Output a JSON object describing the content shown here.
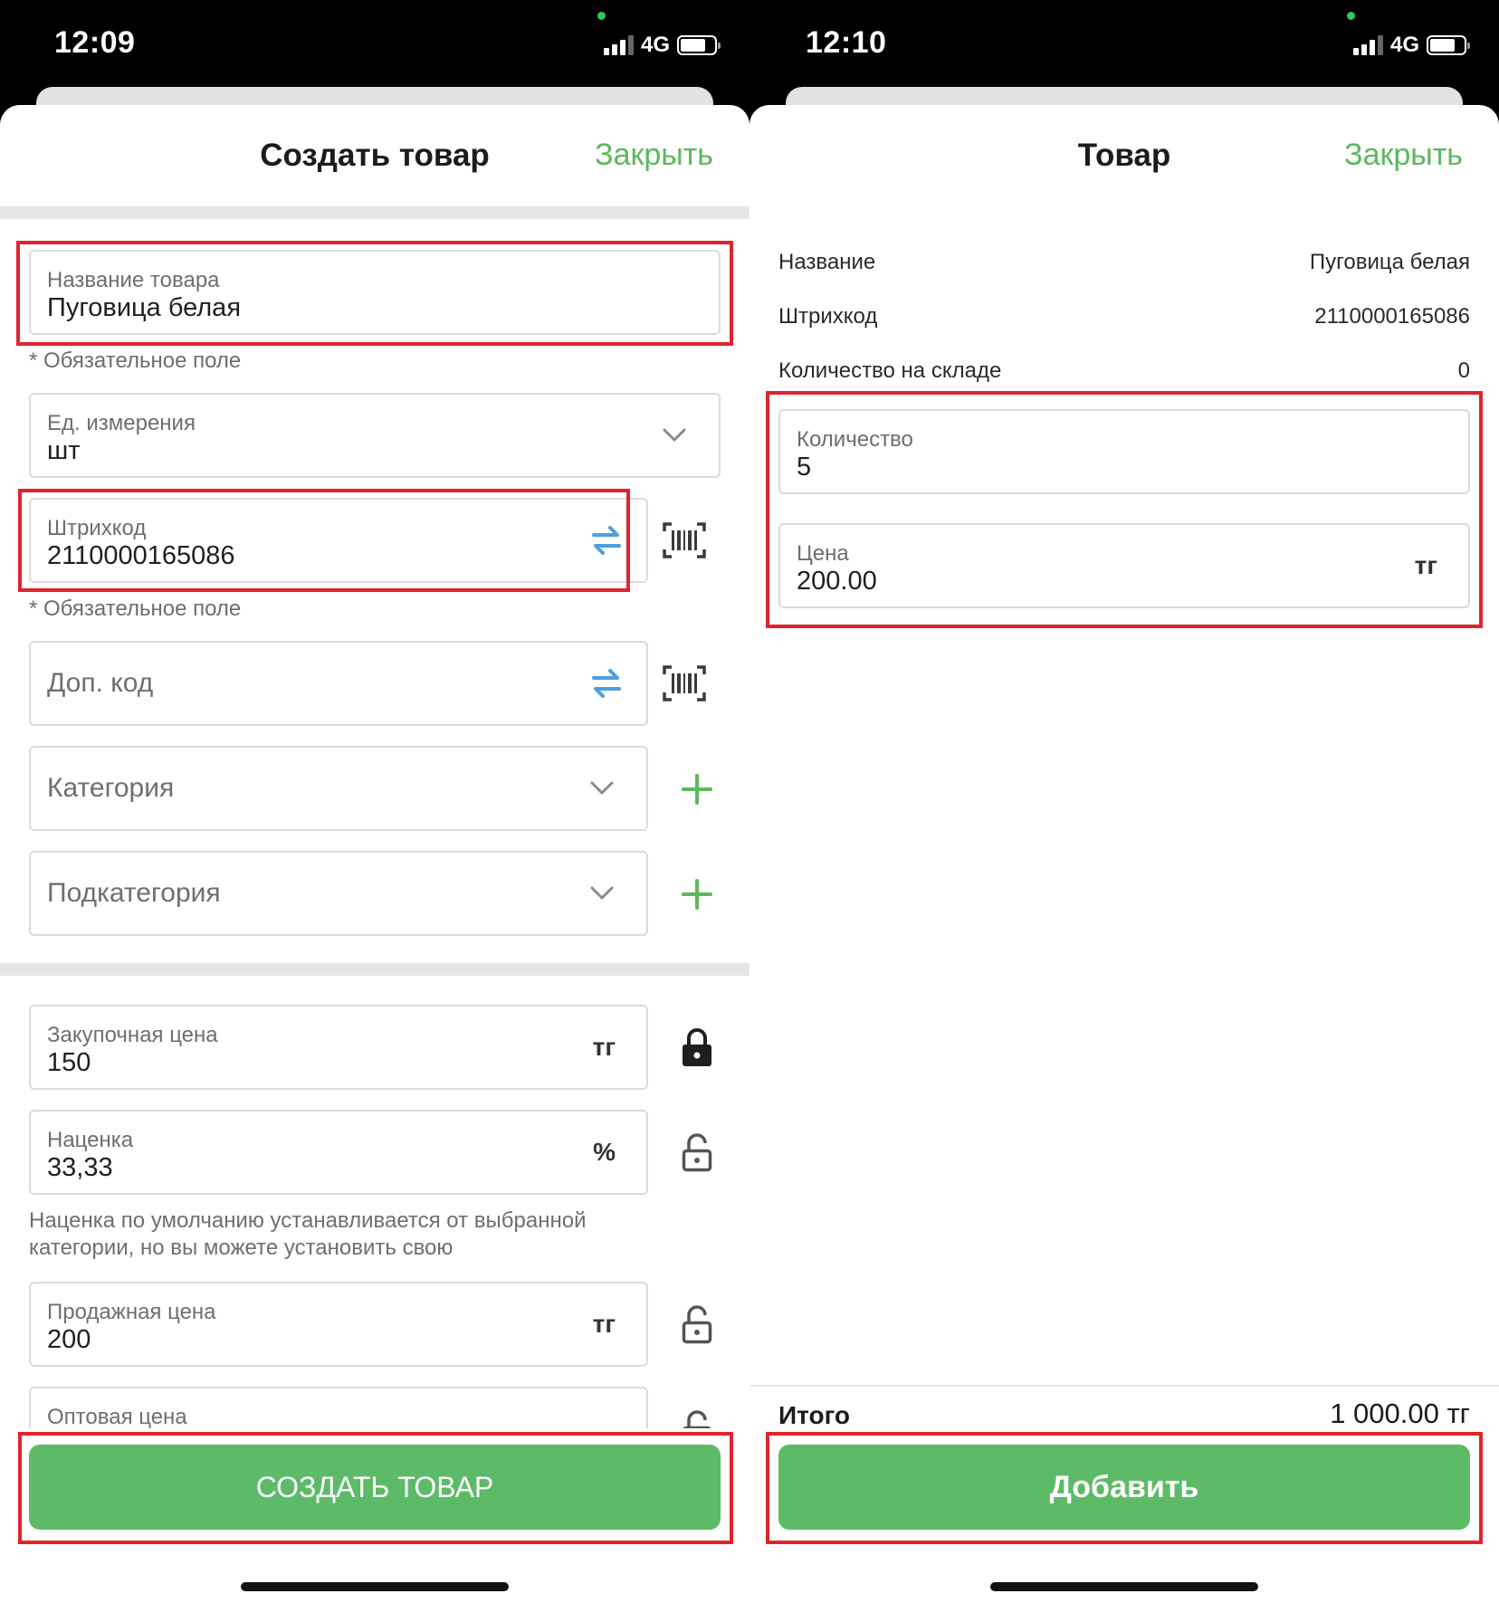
{
  "left": {
    "status": {
      "time": "12:09",
      "network": "4G"
    },
    "header": {
      "title": "Создать товар",
      "close_label": "Закрыть"
    },
    "fields": {
      "name": {
        "label": "Название товара",
        "value": "Пуговица белая",
        "hint": "* Обязательное поле"
      },
      "unit": {
        "label": "Ед. измерения",
        "value": "шт"
      },
      "barcode": {
        "label": "Штрихкод",
        "value": "2110000165086",
        "hint": "* Обязательное поле"
      },
      "extra_code": {
        "placeholder": "Доп. код"
      },
      "category": {
        "placeholder": "Категория"
      },
      "subcategory": {
        "placeholder": "Подкатегория"
      },
      "purchase_price": {
        "label": "Закупочная цена",
        "value": "150",
        "suffix": "тг"
      },
      "markup": {
        "label": "Наценка",
        "value": "33,33",
        "suffix": "%",
        "hint": "Наценка по умолчанию устанавливается от выбранной категории, но вы можете установить свою"
      },
      "sale_price": {
        "label": "Продажная цена",
        "value": "200",
        "suffix": "тг"
      },
      "wholesale_price": {
        "label": "Оптовая цена"
      }
    },
    "create_button_label": "СОЗДАТЬ ТОВАР"
  },
  "right": {
    "status": {
      "time": "12:10",
      "network": "4G"
    },
    "header": {
      "title": "Товар",
      "close_label": "Закрыть"
    },
    "info": [
      {
        "label": "Название",
        "value": "Пуговица белая"
      },
      {
        "label": "Штрихкод",
        "value": "2110000165086"
      },
      {
        "label": "Количество на складе",
        "value": "0"
      }
    ],
    "fields": {
      "quantity": {
        "label": "Количество",
        "value": "5"
      },
      "price": {
        "label": "Цена",
        "value": "200.00",
        "suffix": "тг"
      }
    },
    "total": {
      "label": "Итого",
      "value": "1 000.00 тг"
    },
    "add_button_label": "Добавить"
  },
  "colors": {
    "accent": "#5dbb68",
    "link": "#5cb85c",
    "highlight": "#e0242f",
    "swap_icon": "#4a9fe0"
  },
  "icons": [
    "chevron-down-icon",
    "swap-icon",
    "barcode-scan-icon",
    "plus-icon",
    "lock-closed-icon",
    "lock-open-icon"
  ]
}
